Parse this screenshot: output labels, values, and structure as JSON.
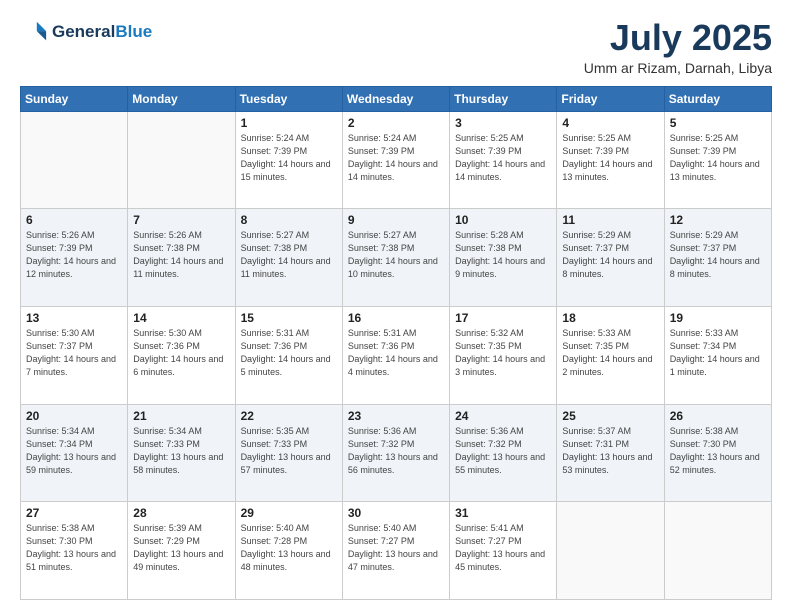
{
  "logo": {
    "line1": "General",
    "line2": "Blue"
  },
  "title": "July 2025",
  "location": "Umm ar Rizam, Darnah, Libya",
  "days_of_week": [
    "Sunday",
    "Monday",
    "Tuesday",
    "Wednesday",
    "Thursday",
    "Friday",
    "Saturday"
  ],
  "weeks": [
    [
      {
        "day": "",
        "info": ""
      },
      {
        "day": "",
        "info": ""
      },
      {
        "day": "1",
        "info": "Sunrise: 5:24 AM\nSunset: 7:39 PM\nDaylight: 14 hours and 15 minutes."
      },
      {
        "day": "2",
        "info": "Sunrise: 5:24 AM\nSunset: 7:39 PM\nDaylight: 14 hours and 14 minutes."
      },
      {
        "day": "3",
        "info": "Sunrise: 5:25 AM\nSunset: 7:39 PM\nDaylight: 14 hours and 14 minutes."
      },
      {
        "day": "4",
        "info": "Sunrise: 5:25 AM\nSunset: 7:39 PM\nDaylight: 14 hours and 13 minutes."
      },
      {
        "day": "5",
        "info": "Sunrise: 5:25 AM\nSunset: 7:39 PM\nDaylight: 14 hours and 13 minutes."
      }
    ],
    [
      {
        "day": "6",
        "info": "Sunrise: 5:26 AM\nSunset: 7:39 PM\nDaylight: 14 hours and 12 minutes."
      },
      {
        "day": "7",
        "info": "Sunrise: 5:26 AM\nSunset: 7:38 PM\nDaylight: 14 hours and 11 minutes."
      },
      {
        "day": "8",
        "info": "Sunrise: 5:27 AM\nSunset: 7:38 PM\nDaylight: 14 hours and 11 minutes."
      },
      {
        "day": "9",
        "info": "Sunrise: 5:27 AM\nSunset: 7:38 PM\nDaylight: 14 hours and 10 minutes."
      },
      {
        "day": "10",
        "info": "Sunrise: 5:28 AM\nSunset: 7:38 PM\nDaylight: 14 hours and 9 minutes."
      },
      {
        "day": "11",
        "info": "Sunrise: 5:29 AM\nSunset: 7:37 PM\nDaylight: 14 hours and 8 minutes."
      },
      {
        "day": "12",
        "info": "Sunrise: 5:29 AM\nSunset: 7:37 PM\nDaylight: 14 hours and 8 minutes."
      }
    ],
    [
      {
        "day": "13",
        "info": "Sunrise: 5:30 AM\nSunset: 7:37 PM\nDaylight: 14 hours and 7 minutes."
      },
      {
        "day": "14",
        "info": "Sunrise: 5:30 AM\nSunset: 7:36 PM\nDaylight: 14 hours and 6 minutes."
      },
      {
        "day": "15",
        "info": "Sunrise: 5:31 AM\nSunset: 7:36 PM\nDaylight: 14 hours and 5 minutes."
      },
      {
        "day": "16",
        "info": "Sunrise: 5:31 AM\nSunset: 7:36 PM\nDaylight: 14 hours and 4 minutes."
      },
      {
        "day": "17",
        "info": "Sunrise: 5:32 AM\nSunset: 7:35 PM\nDaylight: 14 hours and 3 minutes."
      },
      {
        "day": "18",
        "info": "Sunrise: 5:33 AM\nSunset: 7:35 PM\nDaylight: 14 hours and 2 minutes."
      },
      {
        "day": "19",
        "info": "Sunrise: 5:33 AM\nSunset: 7:34 PM\nDaylight: 14 hours and 1 minute."
      }
    ],
    [
      {
        "day": "20",
        "info": "Sunrise: 5:34 AM\nSunset: 7:34 PM\nDaylight: 13 hours and 59 minutes."
      },
      {
        "day": "21",
        "info": "Sunrise: 5:34 AM\nSunset: 7:33 PM\nDaylight: 13 hours and 58 minutes."
      },
      {
        "day": "22",
        "info": "Sunrise: 5:35 AM\nSunset: 7:33 PM\nDaylight: 13 hours and 57 minutes."
      },
      {
        "day": "23",
        "info": "Sunrise: 5:36 AM\nSunset: 7:32 PM\nDaylight: 13 hours and 56 minutes."
      },
      {
        "day": "24",
        "info": "Sunrise: 5:36 AM\nSunset: 7:32 PM\nDaylight: 13 hours and 55 minutes."
      },
      {
        "day": "25",
        "info": "Sunrise: 5:37 AM\nSunset: 7:31 PM\nDaylight: 13 hours and 53 minutes."
      },
      {
        "day": "26",
        "info": "Sunrise: 5:38 AM\nSunset: 7:30 PM\nDaylight: 13 hours and 52 minutes."
      }
    ],
    [
      {
        "day": "27",
        "info": "Sunrise: 5:38 AM\nSunset: 7:30 PM\nDaylight: 13 hours and 51 minutes."
      },
      {
        "day": "28",
        "info": "Sunrise: 5:39 AM\nSunset: 7:29 PM\nDaylight: 13 hours and 49 minutes."
      },
      {
        "day": "29",
        "info": "Sunrise: 5:40 AM\nSunset: 7:28 PM\nDaylight: 13 hours and 48 minutes."
      },
      {
        "day": "30",
        "info": "Sunrise: 5:40 AM\nSunset: 7:27 PM\nDaylight: 13 hours and 47 minutes."
      },
      {
        "day": "31",
        "info": "Sunrise: 5:41 AM\nSunset: 7:27 PM\nDaylight: 13 hours and 45 minutes."
      },
      {
        "day": "",
        "info": ""
      },
      {
        "day": "",
        "info": ""
      }
    ]
  ]
}
